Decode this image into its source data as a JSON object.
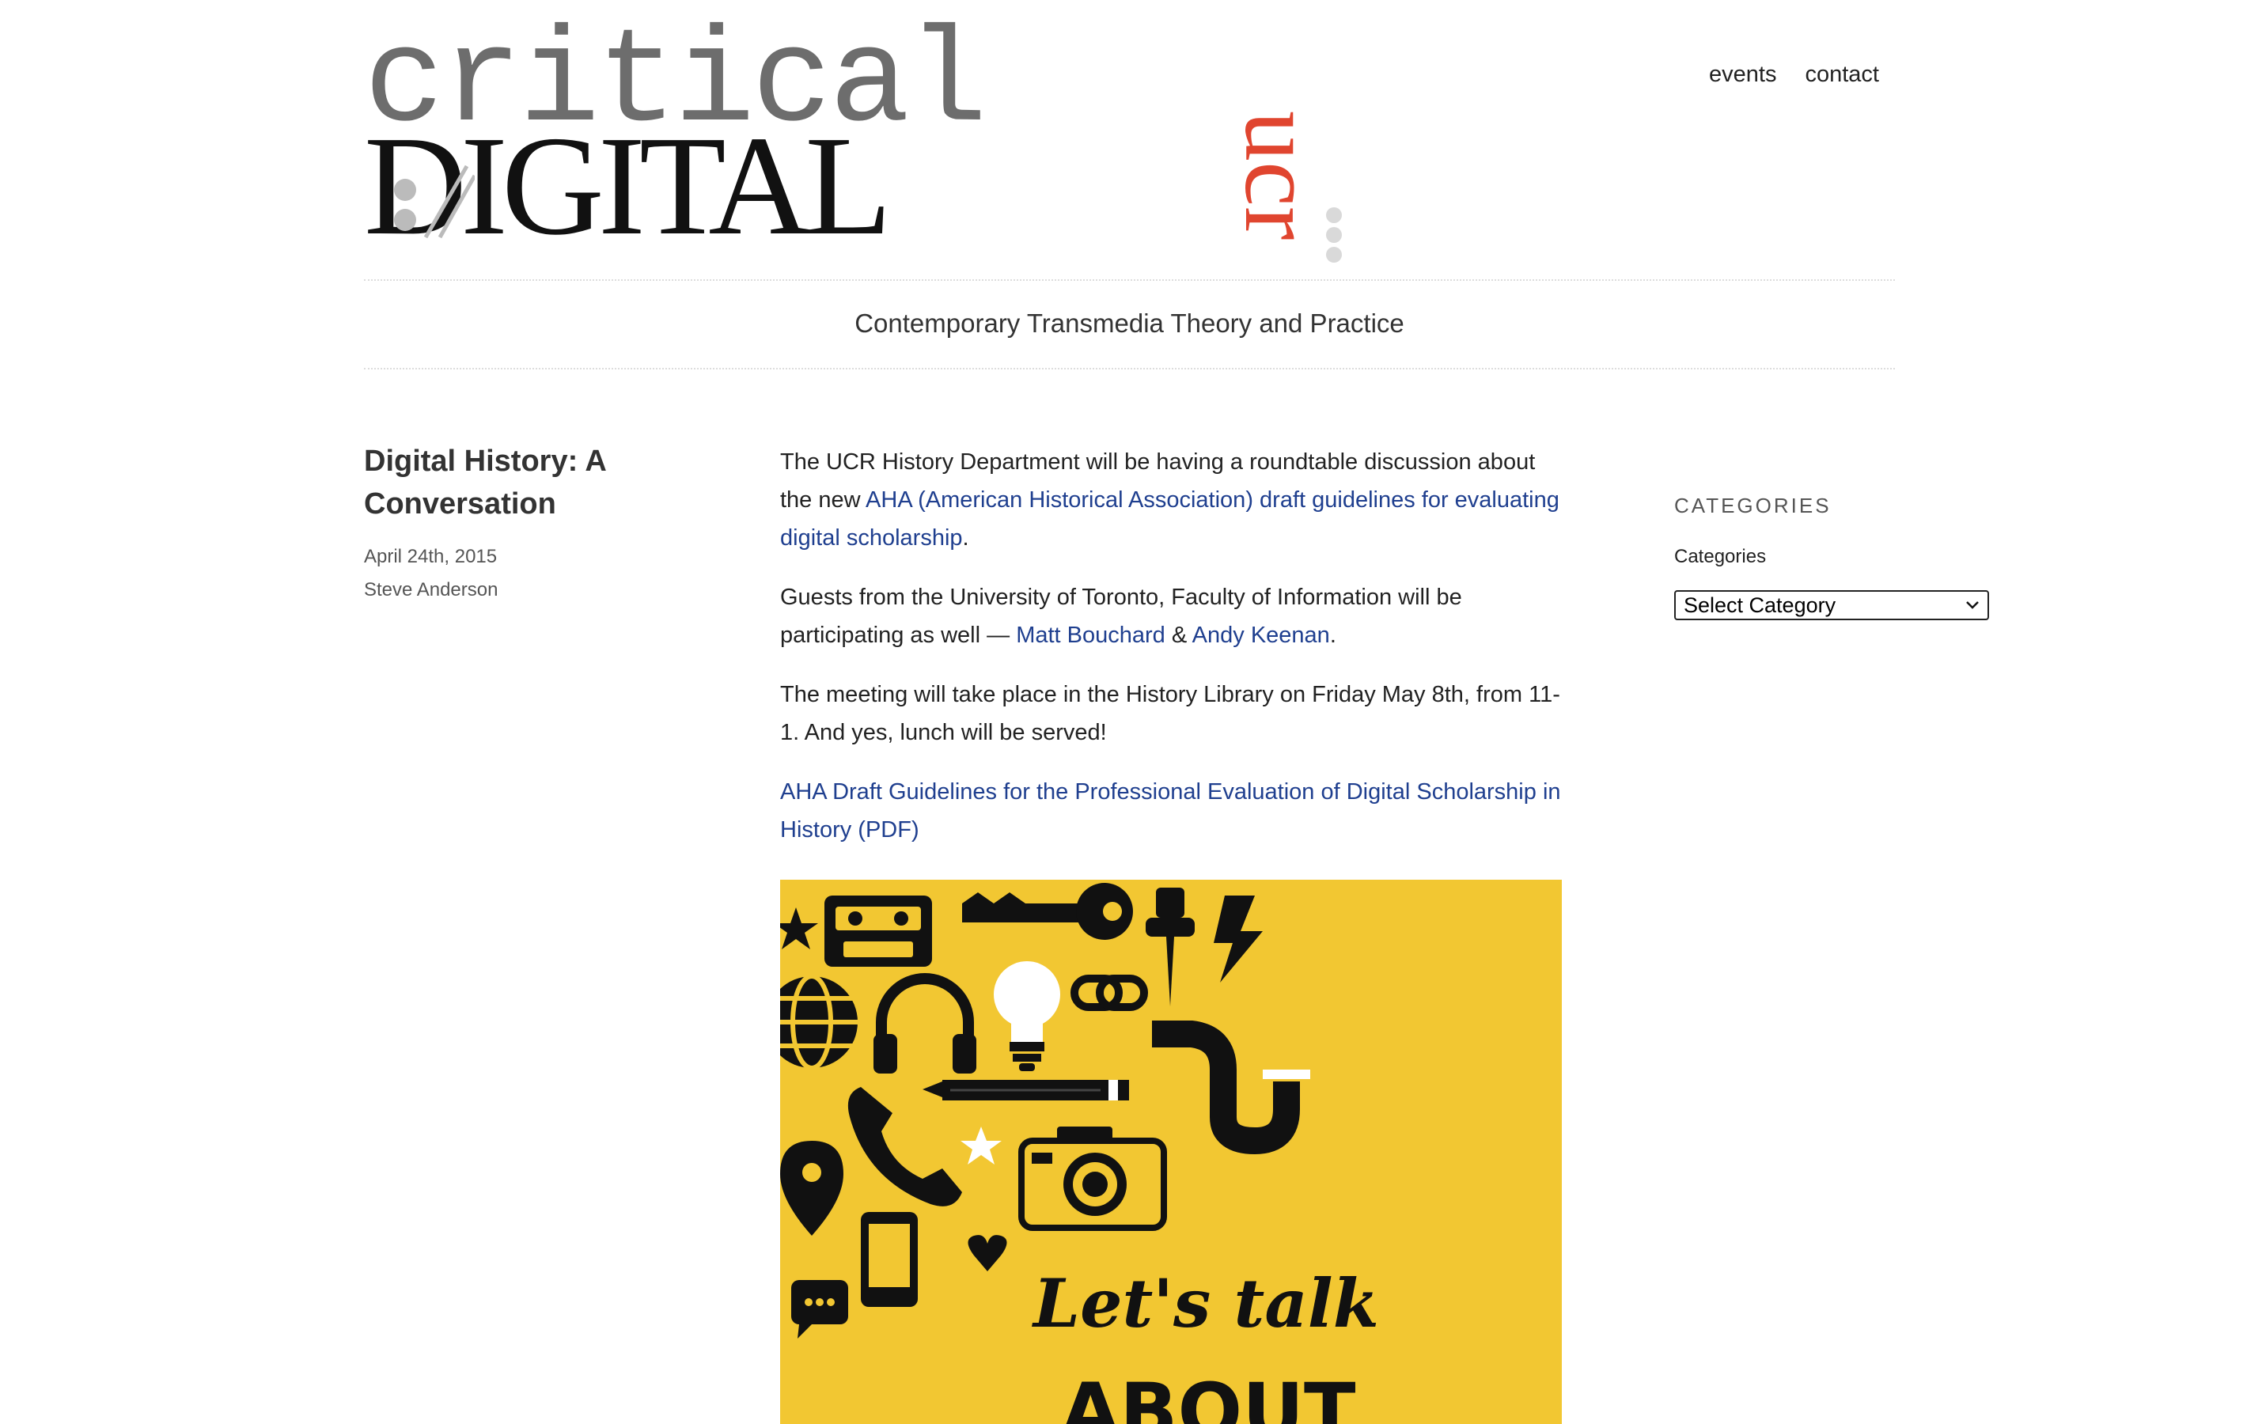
{
  "site": {
    "logo_text_top": "critical",
    "logo_text_bottom": "DIGITAL",
    "logo_text_mark": "ucr",
    "tagline": "Contemporary Transmedia Theory and Practice",
    "brand_red": "#e0452f"
  },
  "nav": {
    "items": [
      {
        "label": "events"
      },
      {
        "label": "contact"
      }
    ]
  },
  "post": {
    "title": "Digital History: A Conversation",
    "date": "April 24th, 2015",
    "author": "Steve Anderson",
    "p1_pre": "The UCR History Department will be having a roundtable discussion about the new ",
    "p1_link": "AHA (American Historical Association) draft guidelines for evaluating digital scholarship",
    "p1_post": ".",
    "p2_pre": "Guests from the University of Toronto, Faculty of Information will be participating as well — ",
    "p2_link1": "Matt Bouchard",
    "p2_mid": " & ",
    "p2_link2": "Andy Keenan",
    "p2_post": ".",
    "p3": "The meeting will take place in the History Library on Friday May 8th, from 11-1. And yes, lunch will be served!",
    "pdf_link": "AHA Draft Guidelines for the Professional Evaluation of Digital Scholarship in History (PDF)",
    "image": {
      "line1": "Let's talk",
      "line2": "ABOUT",
      "background": "#f2c732",
      "icons": [
        "star-icon",
        "cassette-icon",
        "key-icon",
        "pushpin-icon",
        "lightning-icon",
        "globe-icon",
        "headphones-icon",
        "lightbulb-icon",
        "link-icon",
        "pipe-icon",
        "pencil-icon",
        "phone-icon",
        "camera-icon",
        "location-pin-icon",
        "smartphone-icon",
        "heart-icon",
        "chat-bubble-icon"
      ]
    }
  },
  "sidebar": {
    "heading": "CATEGORIES",
    "label": "Categories",
    "select_value": "Select Category"
  }
}
